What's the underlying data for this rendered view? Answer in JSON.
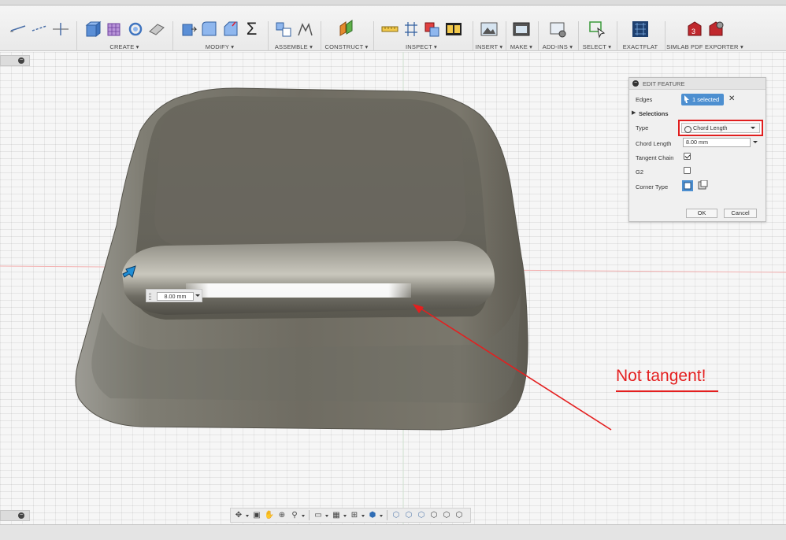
{
  "toolbar": {
    "groups": [
      {
        "label": "CREATE ▾"
      },
      {
        "label": "MODIFY ▾"
      },
      {
        "label": "ASSEMBLE ▾"
      },
      {
        "label": "CONSTRUCT ▾"
      },
      {
        "label": "INSPECT ▾"
      },
      {
        "label": "INSERT ▾"
      },
      {
        "label": "MAKE ▾"
      },
      {
        "label": "ADD-INS ▾"
      },
      {
        "label": "SELECT ▾"
      },
      {
        "label": "EXACTFLAT"
      },
      {
        "label": "SIMLAB PDF EXPORTER ▾"
      }
    ],
    "sketch_icons": [
      "line-sketch-icon",
      "dashed-line-sketch-icon",
      "crosshair-sketch-icon"
    ],
    "sum_glyph": "Σ"
  },
  "edit_feature": {
    "title": "EDIT FEATURE",
    "collapse_glyph": "−",
    "edges_label": "Edges",
    "edges_value": "1 selected",
    "clear_glyph": "✕",
    "selections_label": "Selections",
    "type_label": "Type",
    "type_value": "Chord Length",
    "chord_length_label": "Chord Length",
    "chord_length_value": "8.00 mm",
    "tangent_chain_label": "Tangent Chain",
    "tangent_chain_checked": true,
    "g2_label": "G2",
    "g2_checked": false,
    "corner_type_label": "Corner Type",
    "ok_label": "OK",
    "cancel_label": "Cancel"
  },
  "viewport": {
    "dimension_value": "8.00 mm",
    "annotation_text": "Not tangent!",
    "annotation_color": "#e41f1f"
  },
  "side_buttons": {
    "top_glyph": "−",
    "bottom_glyph": "−"
  },
  "colors": {
    "accent": "#4d8fd0",
    "highlight_red": "#e01e1e",
    "body_gray": "#7d7b72"
  }
}
